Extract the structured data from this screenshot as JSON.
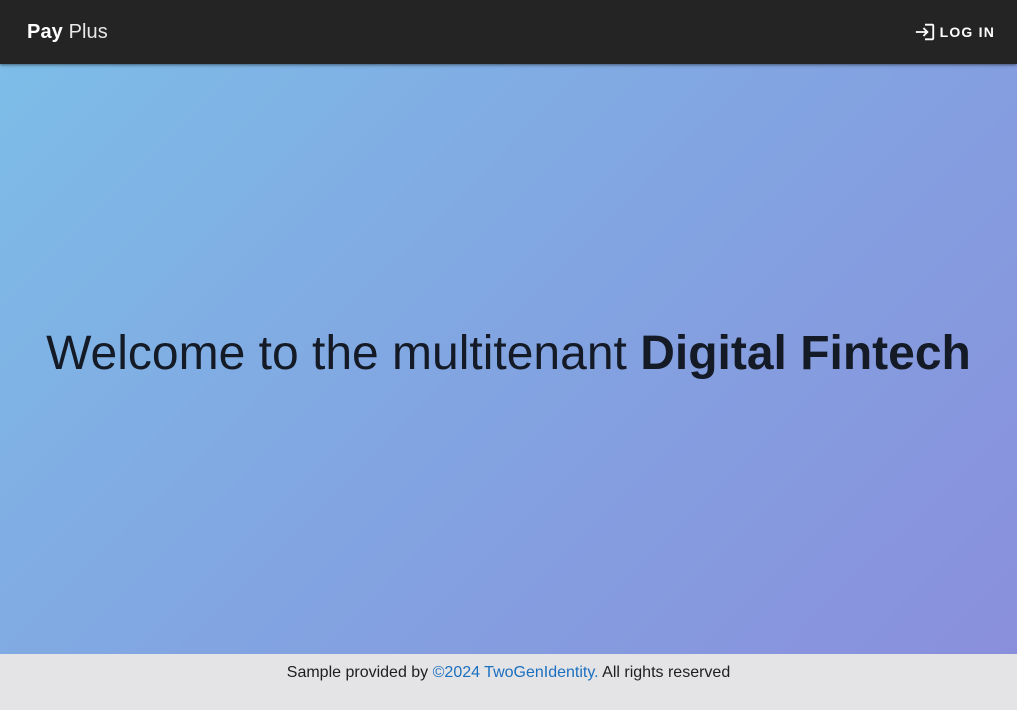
{
  "header": {
    "brand_bold": "Pay",
    "brand_light": "Plus",
    "login_label": "LOG IN",
    "login_icon": "login-icon"
  },
  "hero": {
    "headline_light": "Welcome to the multitenant",
    "headline_bold": "Digital Fintech"
  },
  "footer": {
    "prefix": "Sample provided by",
    "link_text": "©2024 TwoGenIdentity.",
    "suffix": "All rights reserved"
  },
  "colors": {
    "topbar": "#242424",
    "gradient_start": "#7dbde8",
    "gradient_end": "#8a8fdc",
    "footer_bg": "#e4e4e6",
    "link": "#1a6fc0"
  }
}
